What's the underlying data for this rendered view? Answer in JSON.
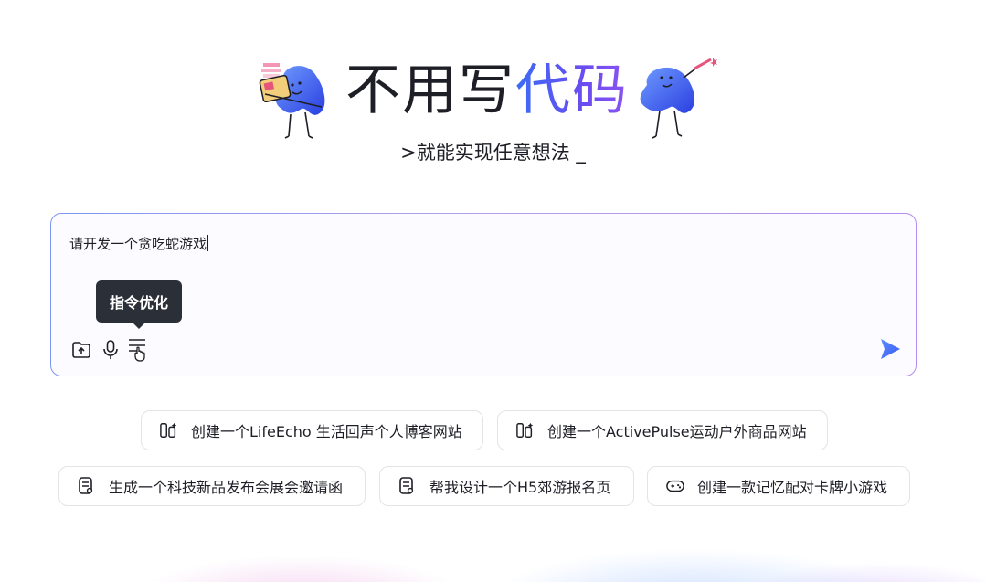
{
  "hero": {
    "title_plain": "不用写",
    "title_highlight": "代码",
    "subtitle": ">就能实现任意想法 _"
  },
  "composer": {
    "prompt_text": "请开发一个贪吃蛇游戏",
    "tooltip": "指令优化",
    "tools": [
      "upload-folder-icon",
      "microphone-icon",
      "prompt-optimize-icon"
    ],
    "send_icon": "send-icon"
  },
  "suggestions": [
    {
      "icon": "website-template-icon",
      "label": "创建一个LifeEcho 生活回声个人博客网站"
    },
    {
      "icon": "website-template-icon",
      "label": "创建一个ActivePulse运动户外商品网站"
    },
    {
      "icon": "h5-page-icon",
      "label": "生成一个科技新品发布会展会邀请函"
    },
    {
      "icon": "h5-page-icon",
      "label": "帮我设计一个H5郊游报名页"
    },
    {
      "icon": "gamepad-icon",
      "label": "创建一款记忆配对卡牌小游戏"
    }
  ],
  "colors": {
    "accent_blue": "#3b6cf5",
    "accent_purple": "#8b54f3",
    "tooltip_bg": "#2b2f37"
  }
}
